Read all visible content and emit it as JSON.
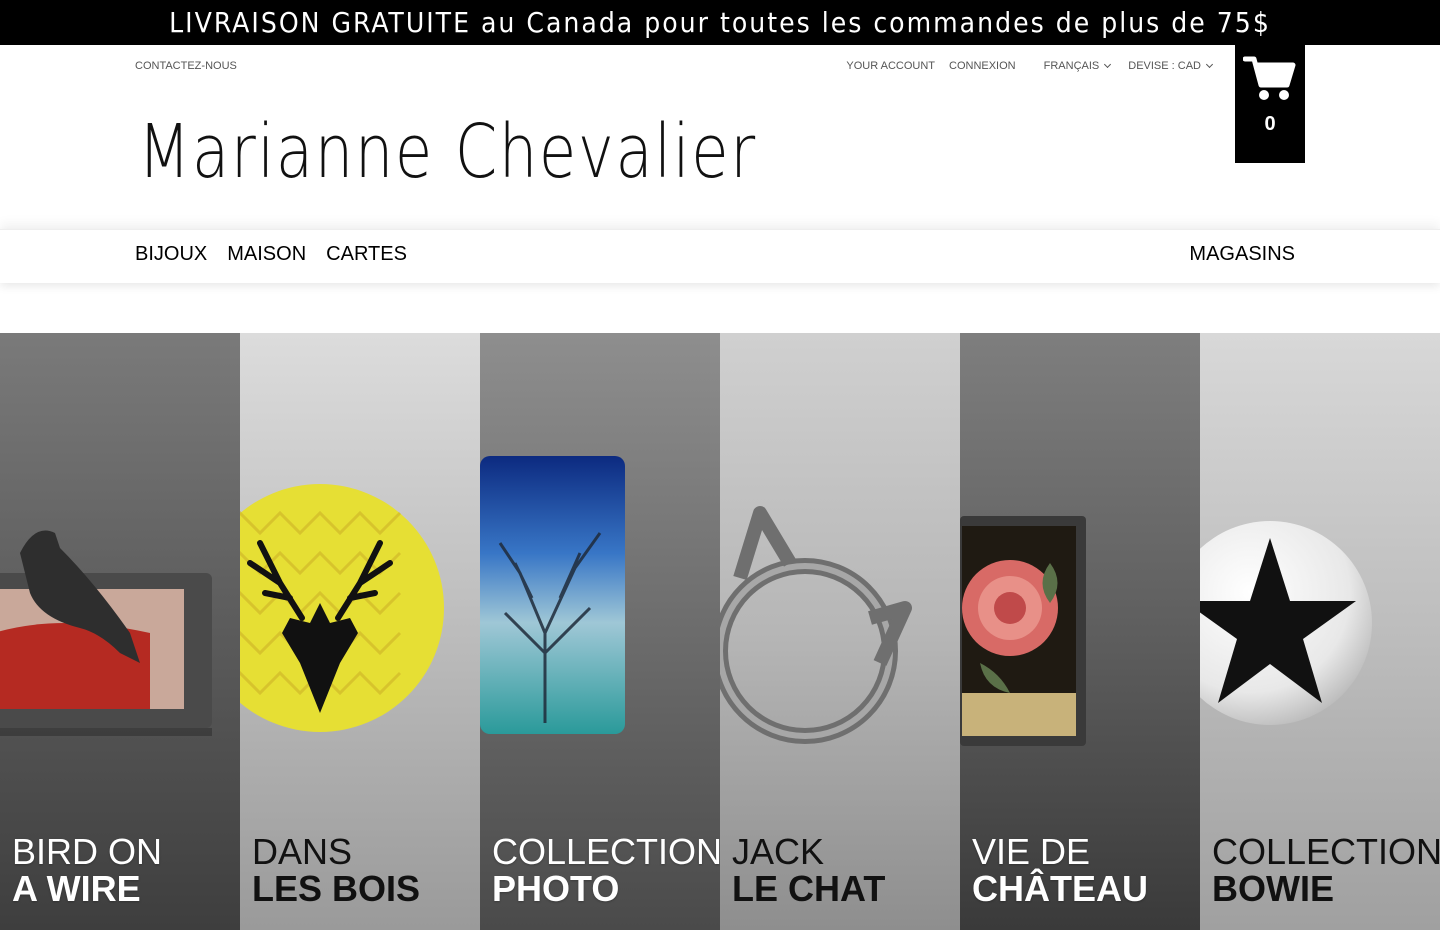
{
  "promo": {
    "text": "LIVRAISON GRATUITE au Canada pour toutes les commandes de plus de 75$"
  },
  "utility": {
    "contact": "CONTACTEZ-NOUS",
    "account": "YOUR ACCOUNT",
    "login": "CONNEXION",
    "language": "FRANÇAIS",
    "currency": "DEVISE : CAD"
  },
  "cart": {
    "count": "0",
    "icon": "shopping-cart-icon"
  },
  "brand": {
    "name": "Marianne Chevalier"
  },
  "nav": {
    "items": [
      "BIJOUX",
      "MAISON",
      "CARTES"
    ],
    "stores": "MAGASINS"
  },
  "collections": [
    {
      "line1": "BIRD ON",
      "line2": "A WIRE"
    },
    {
      "line1": "DANS",
      "line2": "LES BOIS"
    },
    {
      "line1": "COLLECTION",
      "line2": "PHOTO"
    },
    {
      "line1": "JACK",
      "line2": "LE CHAT"
    },
    {
      "line1": "VIE DE",
      "line2": "CHÂTEAU"
    },
    {
      "line1": "COLLECTION",
      "line2": "BOWIE"
    }
  ],
  "colors": {
    "promo_bg": "#000000",
    "cart_bg": "#000000",
    "accent_yellow": "#e4e03a"
  }
}
